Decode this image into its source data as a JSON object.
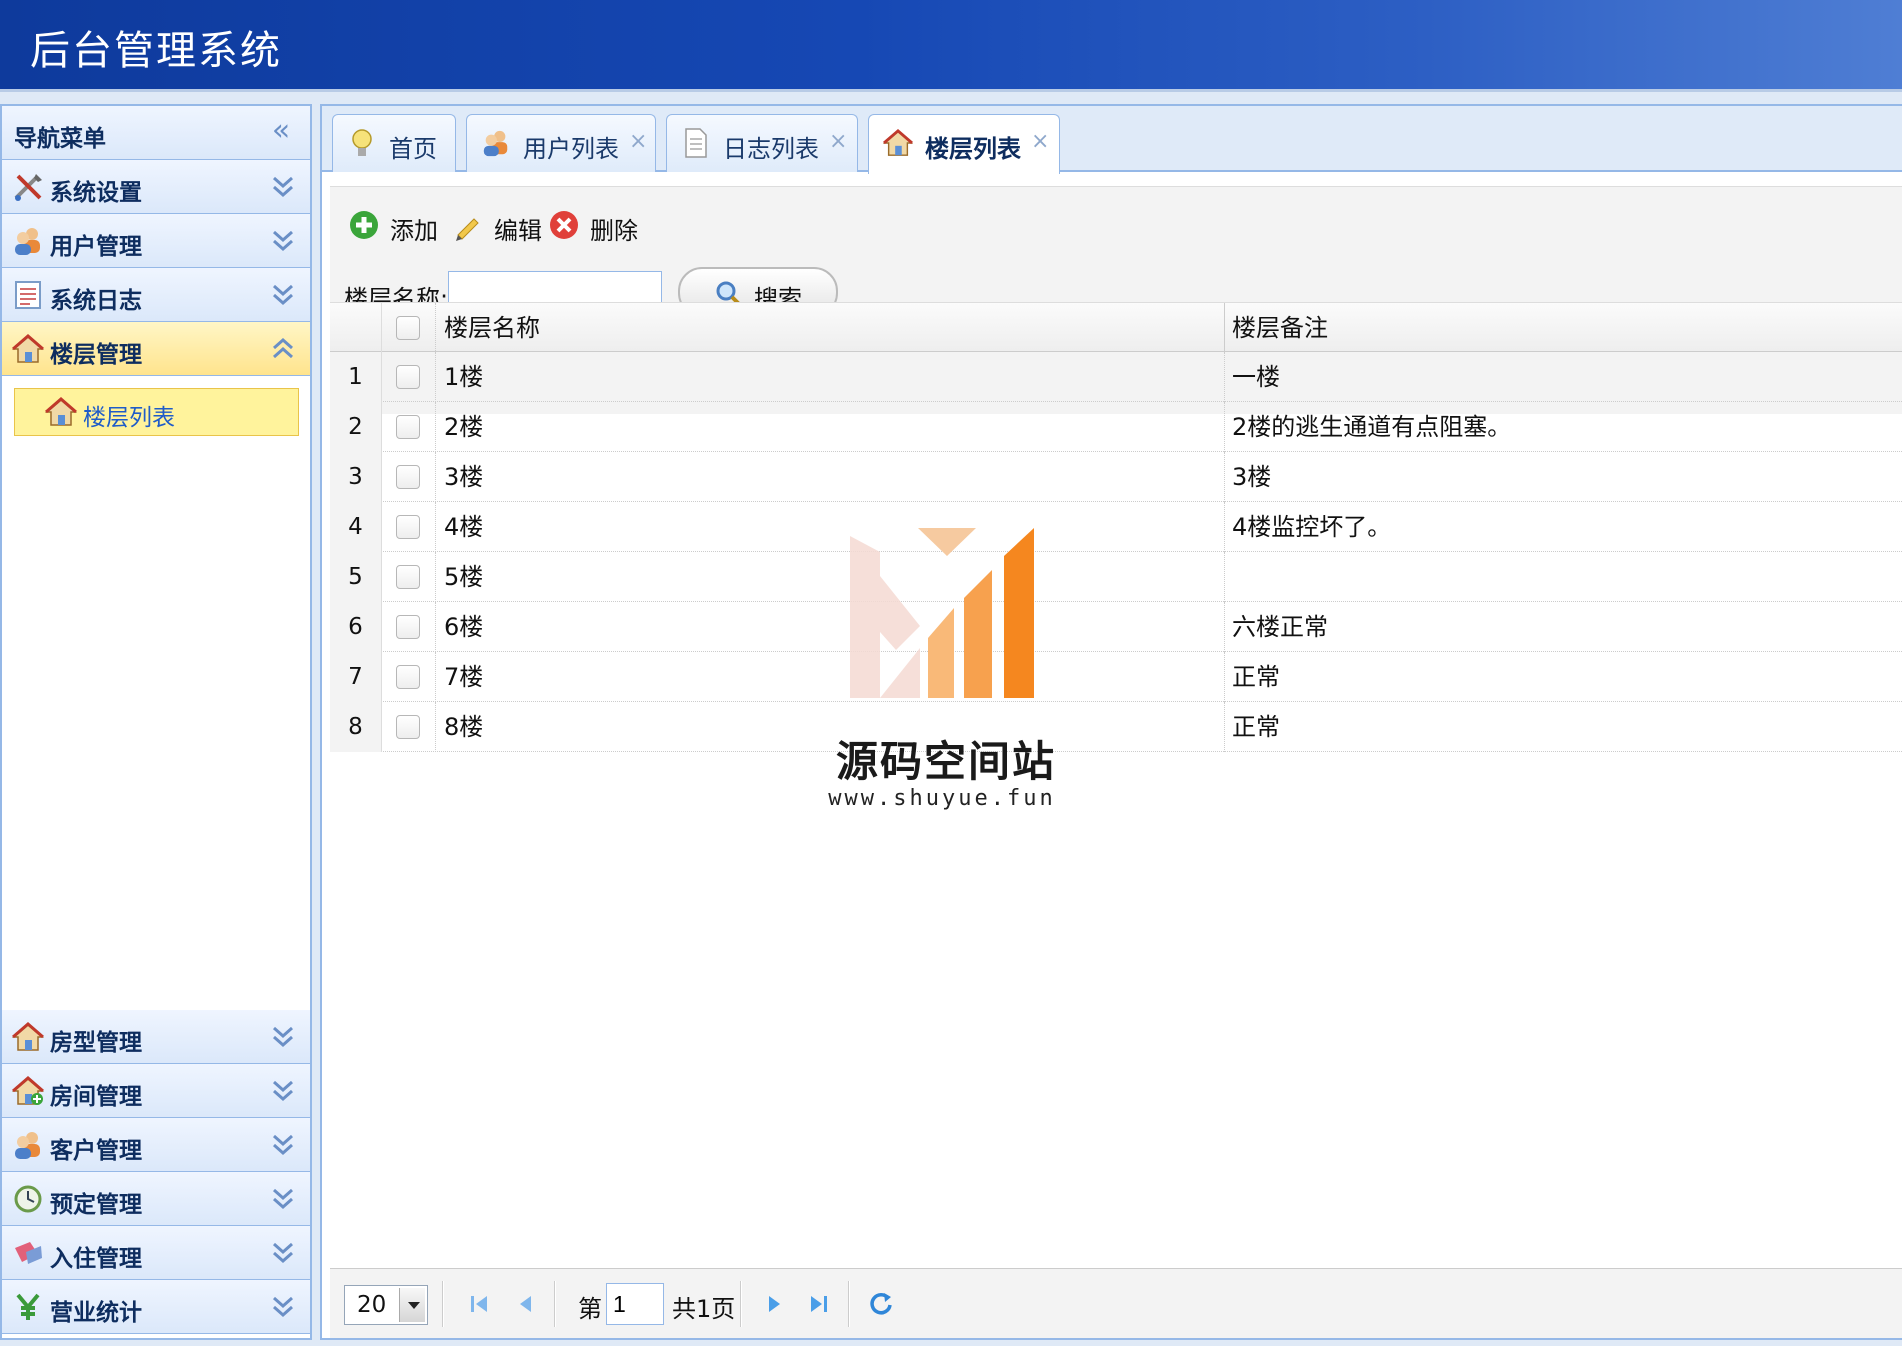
{
  "app": {
    "title": "后台管理系统"
  },
  "sidebar": {
    "header": "导航菜单",
    "groups_top": [
      {
        "label": "系统设置",
        "icon": "tools-icon",
        "expanded": false
      },
      {
        "label": "用户管理",
        "icon": "users-icon",
        "expanded": false
      },
      {
        "label": "系统日志",
        "icon": "log-icon",
        "expanded": false
      },
      {
        "label": "楼层管理",
        "icon": "house-icon",
        "expanded": true
      }
    ],
    "active_sub": {
      "label": "楼层列表",
      "icon": "house-icon"
    },
    "groups_bottom": [
      {
        "label": "房型管理",
        "icon": "house-icon"
      },
      {
        "label": "房间管理",
        "icon": "house-add-icon"
      },
      {
        "label": "客户管理",
        "icon": "users-icon"
      },
      {
        "label": "预定管理",
        "icon": "clock-icon"
      },
      {
        "label": "入住管理",
        "icon": "checkin-icon"
      },
      {
        "label": "营业统计",
        "icon": "yen-icon"
      }
    ]
  },
  "tabs": [
    {
      "label": "首页",
      "icon": "bulb-icon",
      "closable": false,
      "selected": false
    },
    {
      "label": "用户列表",
      "icon": "users-icon",
      "closable": true,
      "selected": false
    },
    {
      "label": "日志列表",
      "icon": "document-icon",
      "closable": true,
      "selected": false
    },
    {
      "label": "楼层列表",
      "icon": "house-icon",
      "closable": true,
      "selected": true
    }
  ],
  "tab_close": "×",
  "toolbar": {
    "add": "添加",
    "edit": "编辑",
    "delete": "删除"
  },
  "search": {
    "label": "楼层名称:",
    "value": "",
    "button": "搜索"
  },
  "table": {
    "columns": [
      "楼层名称",
      "楼层备注"
    ],
    "rows": [
      {
        "no": "1",
        "name": "1楼",
        "note": "一楼"
      },
      {
        "no": "2",
        "name": "2楼",
        "note": "2楼的逃生通道有点阻塞。"
      },
      {
        "no": "3",
        "name": "3楼",
        "note": "3楼"
      },
      {
        "no": "4",
        "name": "4楼",
        "note": "4楼监控坏了。"
      },
      {
        "no": "5",
        "name": "5楼",
        "note": ""
      },
      {
        "no": "6",
        "name": "6楼",
        "note": "六楼正常"
      },
      {
        "no": "7",
        "name": "7楼",
        "note": "正常"
      },
      {
        "no": "8",
        "name": "8楼",
        "note": "正常"
      }
    ]
  },
  "pager": {
    "page_size": "20",
    "page_prefix": "第",
    "page_value": "1",
    "page_total": "共1页"
  },
  "watermark": {
    "title": "源码空间站",
    "url": "www.shuyue.fun"
  },
  "colors": {
    "header": "#1648b4",
    "border": "#95b8e7",
    "active_group": "#ffe48d",
    "pager_icon": "#4a9ee8",
    "accent_orange": "#f5871f"
  }
}
